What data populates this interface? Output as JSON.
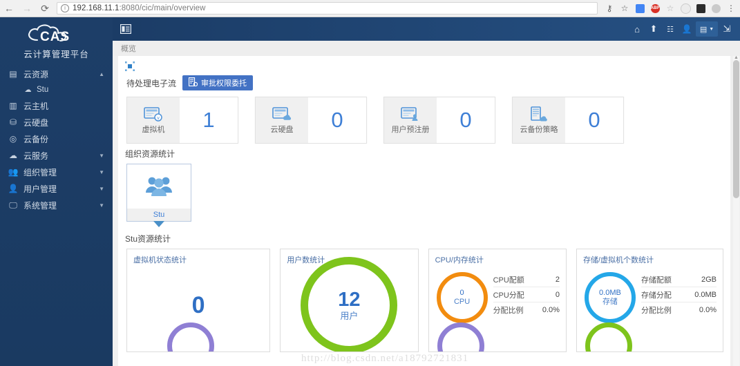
{
  "browser": {
    "back_icon": "back-arrow-icon",
    "forward_icon": "forward-arrow-icon",
    "reload_icon": "reload-icon",
    "url_host": "192.168.11.1",
    "url_rest": ":8080/cic/main/overview",
    "key_icon": "key-icon",
    "star_icon": "star-icon",
    "menu_icon": "browser-menu-icon",
    "extensions": [
      {
        "name": "translate-extension-icon",
        "color": "#4285f4",
        "glyph": ""
      },
      {
        "name": "adblock-extension-icon",
        "color": "#d93025",
        "glyph": "ABP"
      },
      {
        "name": "bookmark-star-extension-icon",
        "color": "#b8b8b8",
        "glyph": ""
      },
      {
        "name": "panda-extension-icon",
        "color": "#e8e8e8",
        "glyph": ""
      },
      {
        "name": "dark-extension-icon",
        "color": "#2b2b2b",
        "glyph": ""
      },
      {
        "name": "shield-extension-icon",
        "color": "#c9c9c9",
        "glyph": ""
      }
    ]
  },
  "sidebar": {
    "logo_text": "CAS",
    "logo_subtitle": "云计算管理平台",
    "items": [
      {
        "label": "云资源",
        "icon": "cloud-resource-icon",
        "caret": "▲",
        "expanded": true
      },
      {
        "label": "Stu",
        "icon": "cloud-small-icon",
        "sub": true
      },
      {
        "label": "云主机",
        "icon": "server-icon",
        "caret": ""
      },
      {
        "label": "云硬盘",
        "icon": "disk-icon",
        "caret": ""
      },
      {
        "label": "云备份",
        "icon": "backup-icon",
        "caret": ""
      },
      {
        "label": "云服务",
        "icon": "cloud-service-icon",
        "caret": "▼"
      },
      {
        "label": "组织管理",
        "icon": "organization-icon",
        "caret": "▼"
      },
      {
        "label": "用户管理",
        "icon": "user-manage-icon",
        "caret": "▼"
      },
      {
        "label": "系统管理",
        "icon": "system-manage-icon",
        "caret": "▼"
      }
    ]
  },
  "header": {
    "menu_icon": "sidebar-toggle-icon",
    "icons": [
      {
        "name": "home-icon",
        "glyph": "⌂"
      },
      {
        "name": "upload-icon",
        "glyph": "⬆"
      },
      {
        "name": "list-icon",
        "glyph": "☰"
      },
      {
        "name": "user-icon",
        "glyph": "👤"
      },
      {
        "name": "window-dropdown-icon",
        "glyph": "▤"
      },
      {
        "name": "logout-icon",
        "glyph": "⇥"
      }
    ]
  },
  "breadcrumb": "概览",
  "main": {
    "expand_icon": "expand-selection-icon",
    "pending": {
      "label": "待处理电子流",
      "button_label": "审批权限委托",
      "button_icon": "delegate-icon",
      "button_color": "#4372c4"
    },
    "stat_cards": [
      {
        "name": "虚拟机",
        "value": "1",
        "icon": "vm-card-icon"
      },
      {
        "name": "云硬盘",
        "value": "0",
        "icon": "disk-card-icon"
      },
      {
        "name": "用户预注册",
        "value": "0",
        "icon": "user-register-card-icon"
      },
      {
        "name": "云备份策略",
        "value": "0",
        "icon": "backup-policy-card-icon"
      }
    ],
    "org_section_title": "组织资源统计",
    "org_card": {
      "name": "Stu",
      "icon": "org-people-icon"
    },
    "res_section_title": "Stu资源统计",
    "panels": [
      {
        "title": "虚拟机状态统计",
        "kind": "number",
        "value": "0"
      },
      {
        "title": "用户数统计",
        "kind": "donut-big",
        "donut_value": "12",
        "donut_label": "用户",
        "donut_color": "#7ec41c"
      },
      {
        "title": "CPU/内存统计",
        "kind": "donut-kv",
        "donut_value": "0",
        "donut_label": "CPU",
        "donut_color": "#f28c0f",
        "rows": [
          {
            "k": "CPU配额",
            "v": "2"
          },
          {
            "k": "CPU分配",
            "v": "0"
          },
          {
            "k": "分配比例",
            "v": "0.0%"
          }
        ]
      },
      {
        "title": "存储/虚拟机个数统计",
        "kind": "donut-kv",
        "donut_value": "0.0MB",
        "donut_label": "存储",
        "donut_color": "#24a7e8",
        "rows": [
          {
            "k": "存储配额",
            "v": "2GB"
          },
          {
            "k": "存储分配",
            "v": "0.0MB"
          },
          {
            "k": "分配比例",
            "v": "0.0%"
          }
        ]
      }
    ],
    "bottom_arc_colors": [
      "#8f7fd4",
      "#7ec41c"
    ]
  },
  "watermark": "http://blog.csdn.net/a18792721831"
}
